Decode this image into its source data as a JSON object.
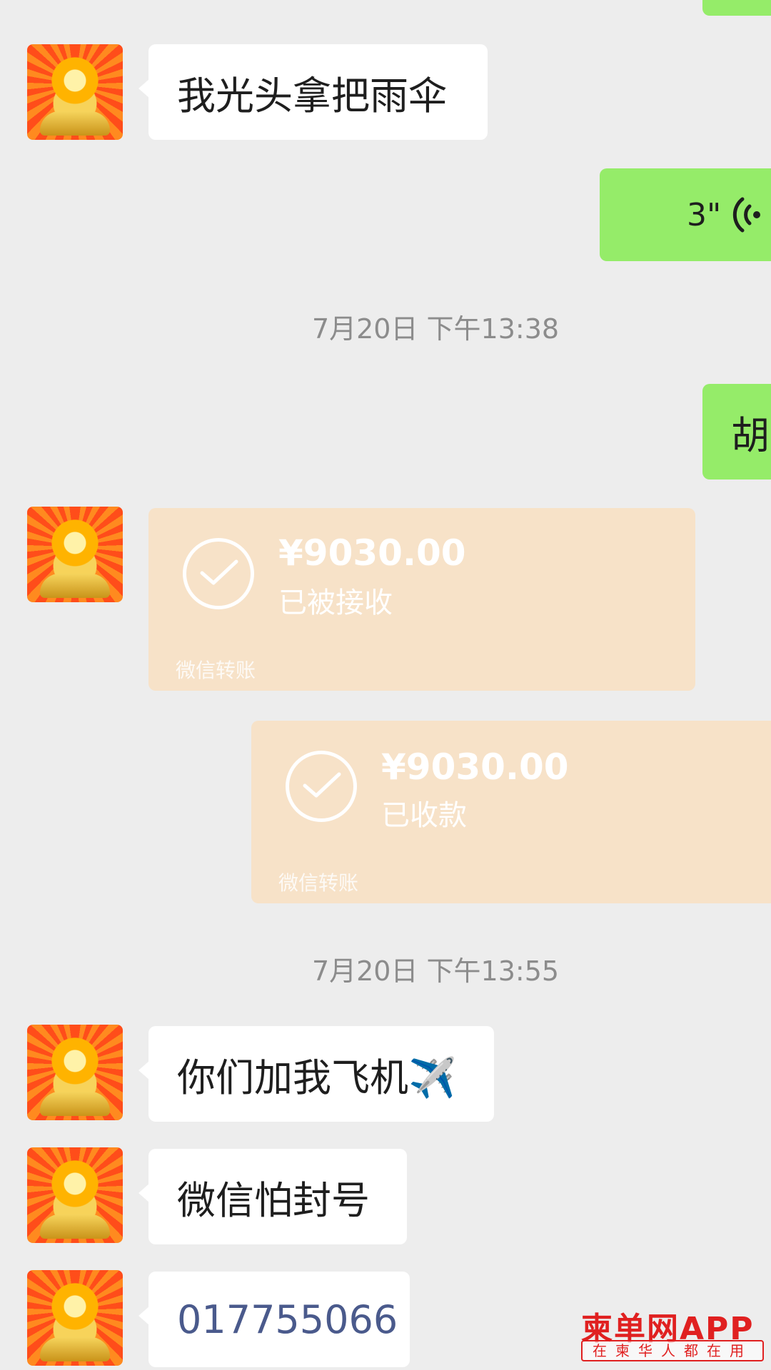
{
  "messages": {
    "m1_text": "我光头拿把雨伞",
    "voice_duration": "3\"",
    "ts1": "7月20日 下午13:38",
    "partial_right_text": "胡",
    "transfer1": {
      "amount": "¥9030.00",
      "status": "已被接收",
      "footer": "微信转账"
    },
    "transfer2": {
      "amount": "¥9030.00",
      "status": "已收款",
      "footer": "微信转账"
    },
    "ts2": "7月20日 下午13:55",
    "m2_text": "你们加我飞机✈️",
    "m3_text": "微信怕封号",
    "m4_text": "017755066"
  },
  "watermark": {
    "brand": "柬单网APP",
    "tagline": "在柬华人都在用"
  },
  "colors": {
    "background": "#ededed",
    "bubble_left": "#ffffff",
    "bubble_right": "#95ec69",
    "transfer_card": "#f7e2c8",
    "watermark_red": "#e02020"
  },
  "icons": {
    "voice": "voice-wave-icon",
    "transfer": "check-circle-icon"
  }
}
